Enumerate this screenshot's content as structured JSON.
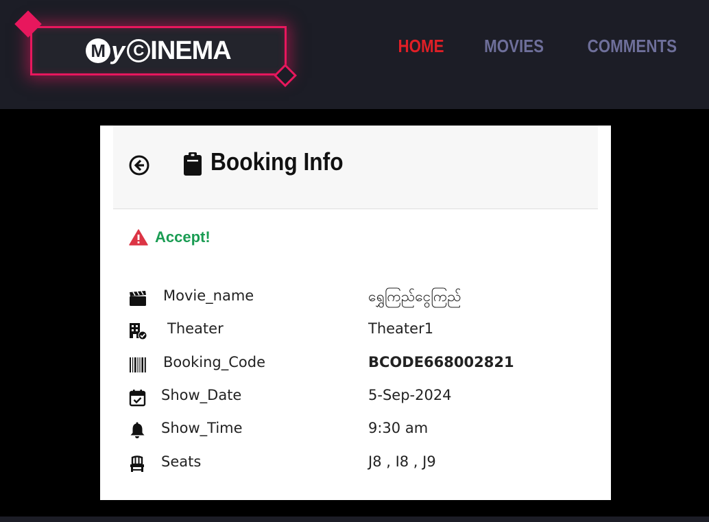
{
  "brand": {
    "logo_letter_m": "M",
    "logo_letter_y": "y",
    "logo_letter_c": "C",
    "logo_word": "INEMA",
    "accent_color": "#e8175d"
  },
  "nav": {
    "items": [
      {
        "label": "HOME",
        "active": true
      },
      {
        "label": "MOVIES",
        "active": false
      },
      {
        "label": "COMMENTS",
        "active": false
      }
    ],
    "active_color": "#e01f26",
    "inactive_color": "#6e6f9a"
  },
  "card": {
    "back_icon": "arrow-left-circle-icon",
    "title_icon": "clipboard-icon",
    "title": "Booking Info",
    "status": {
      "icon": "warning-triangle-icon",
      "text": "Accept!",
      "color": "#1a9c53"
    },
    "rows": [
      {
        "icon": "clapperboard-icon",
        "label": "Movie_name",
        "value": "ရွှေကြည်ငွေကြည်"
      },
      {
        "icon": "theater-building-icon",
        "label": "Theater",
        "value": "Theater1"
      },
      {
        "icon": "barcode-icon",
        "label": "Booking_Code",
        "value": "BCODE668002821"
      },
      {
        "icon": "calendar-check-icon",
        "label": "Show_Date",
        "value": "5-Sep-2024"
      },
      {
        "icon": "bell-icon",
        "label": "Show_Time",
        "value": "9:30 am"
      },
      {
        "icon": "chair-icon",
        "label": "Seats",
        "value": "J8 , I8 , J9"
      }
    ]
  }
}
